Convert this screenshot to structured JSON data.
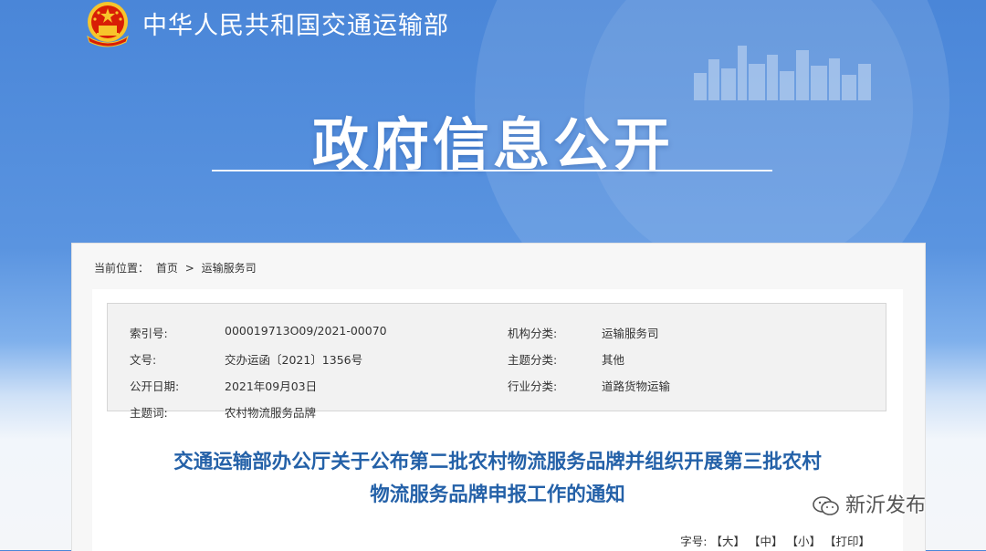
{
  "header": {
    "site_name": "中华人民共和国交通运输部",
    "banner_title": "政府信息公开"
  },
  "breadcrumb": {
    "prefix": "当前位置：",
    "home": "首页",
    "separator": ">",
    "current": "运输服务司"
  },
  "meta": {
    "rows": [
      {
        "label": "索引号:",
        "value": "000019713O09/2021-00070",
        "label2": "机构分类:",
        "value2": "运输服务司"
      },
      {
        "label": "文号:",
        "value": "交办运函〔2021〕1356号",
        "label2": "主题分类:",
        "value2": "其他"
      },
      {
        "label": "公开日期:",
        "value": "2021年09月03日",
        "label2": "行业分类:",
        "value2": "道路货物运输"
      },
      {
        "label": "主题词:",
        "value": "农村物流服务品牌",
        "label2": "",
        "value2": ""
      }
    ]
  },
  "document": {
    "title_line1": "交通运输部办公厅关于公布第二批农村物流服务品牌并组织开展第三批农村",
    "title_line2": "物流服务品牌申报工作的通知"
  },
  "font_size": {
    "label": "字号:",
    "large": "【大】",
    "medium": "【中】",
    "small": "【小】",
    "print": "【打印】"
  },
  "watermark": {
    "text": "新沂发布"
  },
  "colors": {
    "banner_blue": "#4a86d8",
    "title_blue": "#2461a8",
    "emblem_red": "#d81e06",
    "emblem_gold": "#f7c52b"
  },
  "icons": [
    "national-emblem-icon",
    "wechat-icon"
  ]
}
